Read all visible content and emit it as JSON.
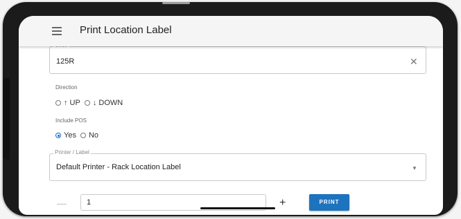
{
  "app": {
    "title": "Print Location Label"
  },
  "code_field": {
    "label": "Code",
    "value": "125R",
    "clear_icon": "close-icon"
  },
  "direction": {
    "label": "Direction",
    "options": [
      {
        "label": "↑ UP",
        "selected": false
      },
      {
        "label": "↓ DOWN",
        "selected": false
      }
    ]
  },
  "include_pos": {
    "label": "Include POS",
    "options": [
      {
        "label": "Yes",
        "selected": true
      },
      {
        "label": "No",
        "selected": false
      }
    ]
  },
  "printer_label": {
    "label": "Printer / Label",
    "value": "Default Printer - Rack Location Label",
    "arrow_icon": "dropdown-arrow-icon"
  },
  "quantity": {
    "minus": "—",
    "value": "1",
    "plus": "+"
  },
  "actions": {
    "print_label": "PRINT"
  },
  "colors": {
    "accent": "#1e73be",
    "radio_selected": "#1565c0"
  }
}
